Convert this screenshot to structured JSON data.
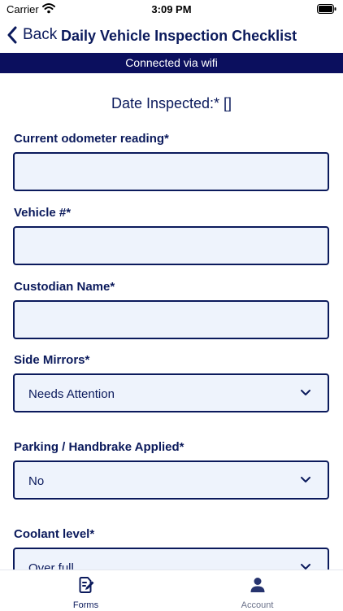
{
  "status_bar": {
    "carrier": "Carrier",
    "time": "3:09 PM"
  },
  "nav": {
    "back_label": "Back",
    "title": "Daily Vehicle Inspection Checklist"
  },
  "banner": {
    "text": "Connected via wifi"
  },
  "form": {
    "date_inspected": "Date Inspected:* []",
    "fields": [
      {
        "label": "Current odometer reading*",
        "value": ""
      },
      {
        "label": "Vehicle #*",
        "value": ""
      },
      {
        "label": "Custodian Name*",
        "value": ""
      },
      {
        "label": "Side Mirrors*",
        "value": "Needs Attention"
      },
      {
        "label": "Parking / Handbrake Applied*",
        "value": "No"
      },
      {
        "label": "Coolant level*",
        "value": "Over full"
      }
    ]
  },
  "tabs": [
    {
      "label": "Forms",
      "icon": "forms-icon",
      "active": true
    },
    {
      "label": "Account",
      "icon": "account-icon",
      "active": false
    }
  ],
  "colors": {
    "primary": "#0b1a5c",
    "banner": "#0b0f5e",
    "input_bg": "#eef3fc",
    "inactive": "#6b728a"
  }
}
